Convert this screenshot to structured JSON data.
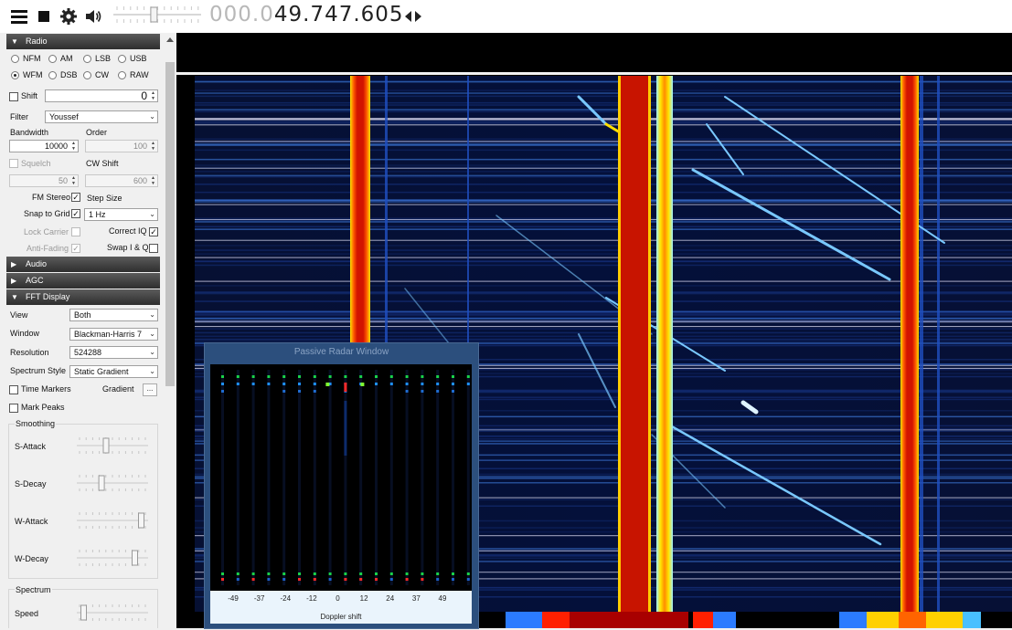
{
  "toolbar": {
    "menu_icon": "hamburger-icon",
    "stop_icon": "stop-icon",
    "settings_icon": "gear-icon",
    "audio_icon": "speaker-icon",
    "frequency_dim": "000.0",
    "frequency_lit": "49.747.605",
    "volume_level": 0.45
  },
  "radio": {
    "section_label": "Radio",
    "modes": [
      "NFM",
      "AM",
      "LSB",
      "USB",
      "WFM",
      "DSB",
      "CW",
      "RAW"
    ],
    "selected_mode": "WFM",
    "shift_label": "Shift",
    "shift_value": "0",
    "filter_label": "Filter",
    "filter_value": "Youssef",
    "bandwidth_label": "Bandwidth",
    "bandwidth_value": "10000",
    "order_label": "Order",
    "order_value": "100",
    "squelch_label": "Squelch",
    "squelch_value": "50",
    "cw_shift_label": "CW Shift",
    "cw_shift_value": "600",
    "fm_stereo_label": "FM Stereo",
    "step_size_label": "Step Size",
    "snap_to_grid_label": "Snap to Grid",
    "step_size_value": "1 Hz",
    "lock_carrier_label": "Lock Carrier",
    "correct_iq_label": "Correct IQ",
    "anti_fading_label": "Anti-Fading",
    "swap_iq_label": "Swap I & Q"
  },
  "audio": {
    "section_label": "Audio"
  },
  "agc": {
    "section_label": "AGC"
  },
  "fft": {
    "section_label": "FFT Display",
    "view_label": "View",
    "view_value": "Both",
    "window_label": "Window",
    "window_value": "Blackman-Harris 7",
    "resolution_label": "Resolution",
    "resolution_value": "524288",
    "spectrum_style_label": "Spectrum Style",
    "spectrum_style_value": "Static Gradient",
    "time_markers_label": "Time Markers",
    "gradient_label": "Gradient",
    "gradient_button": "...",
    "mark_peaks_label": "Mark Peaks",
    "smoothing_label": "Smoothing",
    "s_attack_label": "S-Attack",
    "s_decay_label": "S-Decay",
    "w_attack_label": "W-Attack",
    "w_decay_label": "W-Decay",
    "spectrum_label": "Spectrum",
    "speed_label": "Speed",
    "s_attack_level": 0.4,
    "s_decay_level": 0.33,
    "w_attack_level": 0.95,
    "w_decay_level": 0.85,
    "speed_level": 0.05
  },
  "radar": {
    "title": "Passive Radar Window",
    "x_label": "Doppler shift",
    "ticks": [
      "-49",
      "-37",
      "-24",
      "-12",
      "0",
      "12",
      "24",
      "37",
      "49"
    ]
  },
  "colors": {
    "waterfall_background": "#000030",
    "carrier_red": "#c81400",
    "carrier_yellow": "#ffd200",
    "radar_frame": "#2c4f7d"
  }
}
